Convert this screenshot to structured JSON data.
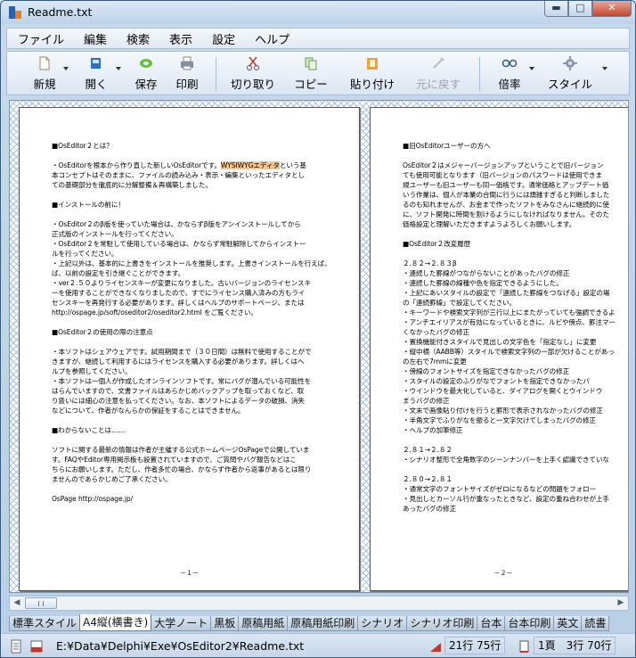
{
  "window": {
    "title": "Readme.txt"
  },
  "menu": [
    "ファイル",
    "編集",
    "検索",
    "表示",
    "設定",
    "ヘルプ"
  ],
  "toolbar": {
    "new": "新規",
    "open": "開く",
    "save": "保存",
    "print": "印刷",
    "cut": "切り取り",
    "copy": "コピー",
    "paste": "貼り付け",
    "undo": "元に戻す",
    "zoom": "倍率",
    "style": "スタイル"
  },
  "page1": {
    "lines": [
      "■OsEditor２とは？",
      "",
      "・OsEditorを根本から作り直した新しいOsEditorです。WYSIWYGエディタという基",
      "本コンセプトはそのままに、ファイルの読み込み・表示・編集といったエディタとし",
      "ての基礎部分を徹底的に分解整備＆再構築しました。",
      "",
      "■インストールの前に！",
      "",
      "・OsEditor２のβ版を使っていた場合は、かならずβ版をアンインストールしてから",
      "正式版のインストールを行ってください。",
      "・OsEditor２を常駐して使用している場合は、かならず常駐解除してからインストー",
      "ルを行ってください。",
      "・上記以外は、基本的に上書きをインストールを推奨します。上書きインストールを行えば、",
      "ば、以前の設定を引き継ぐことができます。",
      "・ver２.５０よりライセンスキーが変更になりました。古いバージョンのライセンスキ",
      "ーを使用することができなくなりましたので、すでにライセンス購入済みの方もライ",
      "センスキーを再発行する必要があります。詳しくはヘルプのサポートページ、または",
      "http://ospage.jp/soft/oseditor2/oseditor2.html をご覧ください。",
      "",
      "■OsEditor２の使用の際の注意点",
      "",
      "・本ソフトはシェアウェアです。試用期間まで（３０日間）は無料で使用することがで",
      "きますが、継続して利用するにはライセンスを購入する必要があります。詳しくはヘ",
      "ルプを参照してください。",
      "・本ソフトは一個人が作成したオンラインソフトです。常にバグが潜んでいる可能性を",
      "はらんでいますので、文書ファイルはあらかじめバックアップを取っておくなど、取",
      "り扱いには細心の注意を払ってください。なお、本ソフトによるデータの破損、消失",
      "などについて、作者がなんらかの保証をすることはできません。",
      "",
      "■わからないことは……",
      "",
      "ソフトに関する最新の情報は作者が主催する公式ホームページOsPageで公開していま",
      "す。FAQやEditor専用掲示板も設置されていますので、ご質問やバグ報告などはこ",
      "ちらにお願いします。ただし、作者多忙の場合、かならず作者から返事があるとは限り",
      "ませんのであらかじめご了承ください。",
      "",
      "OsPage http://ospage.jp/"
    ],
    "highlight": "WYSIWYGエディタ",
    "number": "－１－"
  },
  "page2": {
    "lines": [
      "■旧OsEditorユーザーの方へ",
      "",
      "OsEditor２はメジャーバージョンアップということで旧バージョン",
      "ても使用可能となります（旧バージョンのパスワードは使用できま",
      "規ユーザーも旧ユーザーも同一価格です。通常価格とアップデート価",
      "いう作業は、個人が本業の合間に行うには煩雑すぎると判断しました",
      "るのも知れませんが、お金まで作ったソフトをみなさんに継続的に使",
      "に、ソフト開発に時間を割けるようにしなければなりません。そのた",
      "価格設定と理解いただきますようよろしくお願いします。",
      "",
      "■OsEditor２改変履歴",
      "",
      "２.８２→２.８３β",
      "・連続した罫線がつながらないことがあったバグの修正",
      "・連続した罫線の線種や色を指定できるようにした。",
      "・上記にあいスタイルの設定で「連続した罫線をつなげる」設定の場",
      "の「連続罫線」で設定してください。",
      "・キーワードや検索文字列が三行以上にまたがっていても強調できるよ",
      "・アンチエイリアスが有効になっているときに、ルビや傍点、罫注マー",
      "くなかったバグの修正",
      "・置換機能付きスタイルで見出しの文字色を「指定なし」に変更",
      "・縦中横（ΑΑΒΒ等）スタイルで検索文字列の一部が欠けることがあっ",
      "の左右で7mmに変更",
      "・傍線のフォントサイズを指定できなかったバグの修正",
      "・スタイルの設定のふりがなでフォントを指定できなかったバ",
      "・ウインドウを最大化していると、ダイアログを開くとウインドウ",
      "まうバグの修正",
      "・文末で画像貼り付けを行うと罫形で表示されなかったバグの修正",
      "・半角文字でふりがなを振ると一文字欠けてしまったバグの修正",
      "・ヘルプの加筆修正",
      "",
      "２.８１→２.８２",
      "・シナリオ整形で全角数字のシーンナンバーを上手く認識できていな",
      "",
      "２.８０→２.８１",
      "・通常文字のフォントサイズがゼロになるなどの問題をフォロー",
      "・見出しとカーソル行が重なったときなど、設定の重ね合わせが上手",
      "あったバグの修正"
    ],
    "number": "－２－"
  },
  "tabs": [
    "標準スタイル",
    "A4縦(横書き)",
    "大学ノート",
    "黒板",
    "原稿用紙",
    "原稿用紙印刷",
    "シナリオ",
    "シナリオ印刷",
    "台本",
    "台本印刷",
    "英文",
    "読書"
  ],
  "active_tab": "A4縦(横書き)",
  "status": {
    "path": "E:¥Data¥Delphi¥Exe¥OsEditor2¥Readme.txt",
    "total": "21行 75行",
    "position": "1頁　3行 70行"
  },
  "colors": {
    "highlight": "#f6c48c",
    "page_border": "#555555",
    "frame": "#cfe0f1"
  }
}
